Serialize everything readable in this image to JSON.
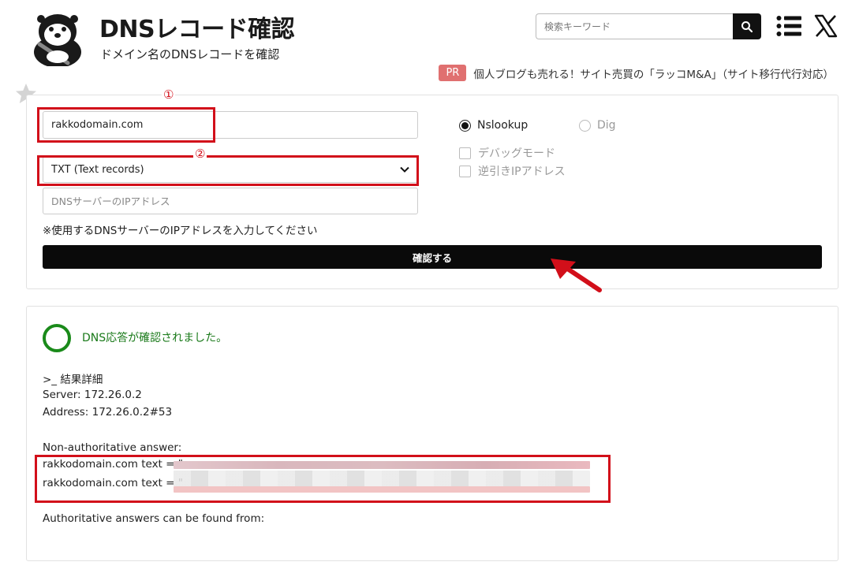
{
  "header": {
    "title": "DNSレコード確認",
    "subtitle": "ドメイン名のDNSレコードを確認",
    "search_placeholder": "検索キーワード"
  },
  "pr": {
    "badge": "PR",
    "text": "個人ブログも売れる！サイト売買の「ラッコM&A」（サイト移行代行対応）"
  },
  "form": {
    "domain_value": "rakkodomain.com",
    "record_type_selected": "TXT (Text records)",
    "dns_server_placeholder": "DNSサーバーのIPアドレス",
    "dns_note": "※使用するDNSサーバーのIPアドレスを入力してください",
    "options": {
      "nslookup_label": "Nslookup",
      "dig_label": "Dig",
      "debug_label": "デバッグモード",
      "reverse_label": "逆引きIPアドレス"
    },
    "submit_label": "確認する"
  },
  "annotations": {
    "step1": "①",
    "step2": "②"
  },
  "result": {
    "status_text": "DNS応答が確認されました。",
    "lines": [
      ">_ 結果詳細",
      "Server: 172.26.0.2",
      "Address: 172.26.0.2#53",
      "Non-authoritative answer:",
      "rakkodomain.com text = \"",
      "rakkodomain.com text = \"",
      "Authoritative answers can be found from:"
    ]
  }
}
